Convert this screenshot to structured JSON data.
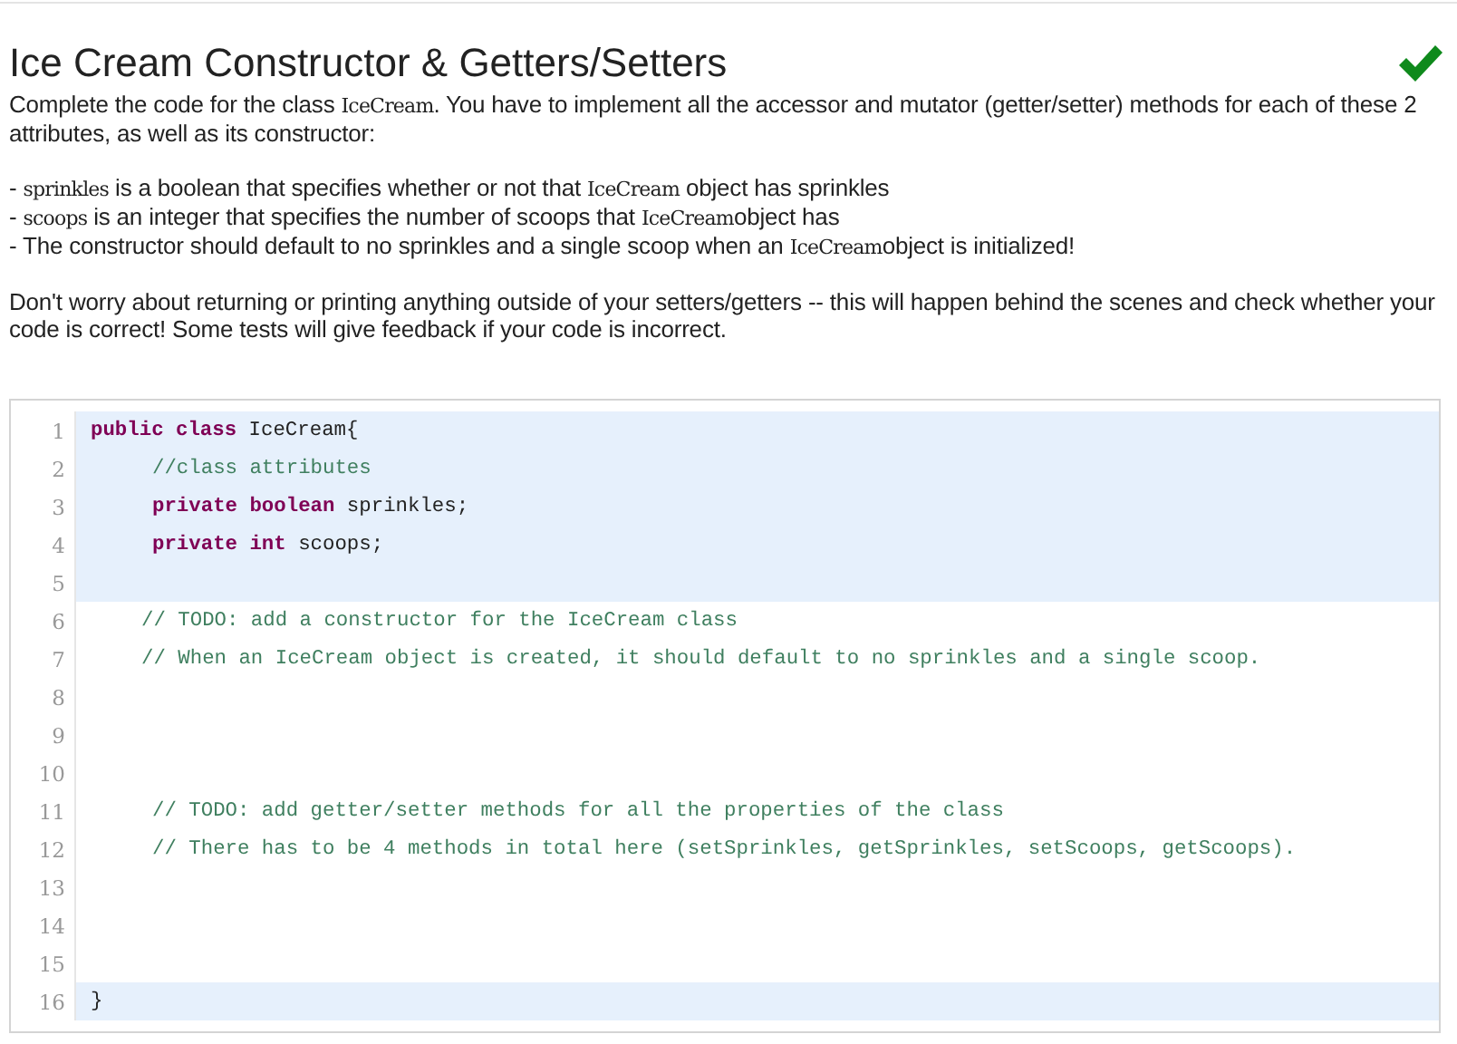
{
  "title": "Ice Cream Constructor & Getters/Setters",
  "completed": true,
  "paragraphs": [
    [
      {
        "kind": "text",
        "text": "Complete the code for the class "
      },
      {
        "kind": "code",
        "text": "IceCream"
      },
      {
        "kind": "text",
        "text": ". You have to implement all the accessor and mutator (getter/setter) methods for each of these 2 attributes, as well as its constructor:"
      }
    ],
    [
      {
        "kind": "text",
        "text": "- "
      },
      {
        "kind": "code",
        "text": "sprinkles"
      },
      {
        "kind": "text",
        "text": " is a boolean that specifies whether or not that "
      },
      {
        "kind": "code",
        "text": "IceCream"
      },
      {
        "kind": "text",
        "text": " object has sprinkles"
      }
    ],
    [
      {
        "kind": "text",
        "text": "- "
      },
      {
        "kind": "code",
        "text": "scoops"
      },
      {
        "kind": "text",
        "text": " is an integer that specifies the number of scoops that "
      },
      {
        "kind": "code",
        "text": "IceCream"
      },
      {
        "kind": "text",
        "text": "object has"
      }
    ],
    [
      {
        "kind": "text",
        "text": "- The constructor should default to no sprinkles and a single scoop when an "
      },
      {
        "kind": "code",
        "text": "IceCream"
      },
      {
        "kind": "text",
        "text": "object is initialized!"
      }
    ],
    [
      {
        "kind": "text",
        "text": "Don't worry about returning or printing anything outside of your setters/getters -- this will happen behind the scenes and check whether your code is correct! Some tests will give feedback if your code is incorrect."
      }
    ]
  ],
  "editor": {
    "lines": [
      {
        "number": "1",
        "highlighted": true,
        "kind": "top",
        "tokens": [
          {
            "kind": "keyword",
            "text": "public class"
          },
          {
            "kind": "plain",
            "text": " IceCream{"
          }
        ]
      },
      {
        "number": "2",
        "highlighted": true,
        "kind": "member",
        "tokens": [
          {
            "kind": "comment",
            "text": "//class attributes"
          }
        ]
      },
      {
        "number": "3",
        "highlighted": true,
        "kind": "member",
        "tokens": [
          {
            "kind": "keyword",
            "text": "private boolean"
          },
          {
            "kind": "plain",
            "text": " sprinkles;"
          }
        ]
      },
      {
        "number": "4",
        "highlighted": true,
        "kind": "member",
        "tokens": [
          {
            "kind": "keyword",
            "text": "private int"
          },
          {
            "kind": "plain",
            "text": " scoops;"
          }
        ]
      },
      {
        "number": "5",
        "highlighted": true,
        "kind": "blank"
      },
      {
        "number": "6",
        "highlighted": false,
        "kind": "note",
        "tokens": [
          {
            "kind": "comment",
            "text": "// TODO: add a constructor for the IceCream class"
          }
        ]
      },
      {
        "number": "7",
        "highlighted": false,
        "kind": "note",
        "tokens": [
          {
            "kind": "comment",
            "text": "// When an IceCream object is created, it should default to no sprinkles and a single scoop."
          }
        ]
      },
      {
        "number": "8",
        "highlighted": false,
        "kind": "blank"
      },
      {
        "number": "9",
        "highlighted": false,
        "kind": "blank"
      },
      {
        "number": "10",
        "highlighted": false,
        "kind": "blank"
      },
      {
        "number": "11",
        "highlighted": false,
        "kind": "member",
        "tokens": [
          {
            "kind": "comment",
            "text": "// TODO: add getter/setter methods for all the properties of the class"
          }
        ]
      },
      {
        "number": "12",
        "highlighted": false,
        "kind": "member",
        "tokens": [
          {
            "kind": "comment",
            "text": "// There has to be 4 methods in total here (setSprinkles, getSprinkles, setScoops, getScoops)."
          }
        ]
      },
      {
        "number": "13",
        "highlighted": false,
        "kind": "blank"
      },
      {
        "number": "14",
        "highlighted": false,
        "kind": "blank"
      },
      {
        "number": "15",
        "highlighted": false,
        "kind": "blank"
      },
      {
        "number": "16",
        "highlighted": true,
        "kind": "top",
        "tokens": [
          {
            "kind": "plain",
            "text": "}"
          }
        ]
      }
    ]
  }
}
